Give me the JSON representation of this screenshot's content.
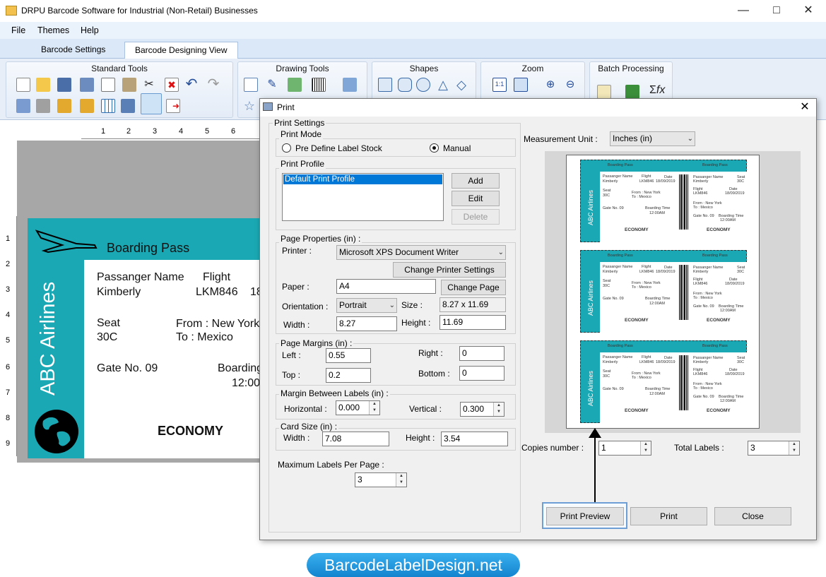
{
  "window": {
    "title": "DRPU Barcode Software for Industrial (Non-Retail) Businesses"
  },
  "menu": [
    "File",
    "Themes",
    "Help"
  ],
  "tabs": [
    {
      "label": "Barcode Settings"
    },
    {
      "label": "Barcode Designing View"
    }
  ],
  "ribbon_groups": [
    "Standard Tools",
    "Drawing Tools",
    "Shapes",
    "Zoom",
    "Batch Processing"
  ],
  "ruler_h": [
    "1",
    "2",
    "3",
    "4",
    "5",
    "6"
  ],
  "ruler_v": [
    "1",
    "2",
    "3",
    "4",
    "5",
    "6",
    "7",
    "8",
    "9"
  ],
  "label": {
    "title": "Boarding Pass",
    "airline": "ABC Airlines",
    "passenger_label": "Passanger Name",
    "passenger": "Kimberly",
    "flight_label": "Flight",
    "flight": "LKM846",
    "flight_cut": "18",
    "seat_label": "Seat",
    "seat": "30C",
    "from": "From : New York",
    "to": "To : Mexico",
    "gate": "Gate No. 09",
    "boarding": "Boarding",
    "boarding_time": "12:00",
    "class": "ECONOMY"
  },
  "dialog": {
    "title": "Print",
    "print_settings": "Print Settings",
    "print_mode": "Print Mode",
    "mode_predefined": "Pre Define Label Stock",
    "mode_manual": "Manual",
    "print_profile": "Print Profile",
    "profiles": [
      "Default Print Profile"
    ],
    "btn_add": "Add",
    "btn_edit": "Edit",
    "btn_delete": "Delete",
    "page_properties": "Page Properties (in) :",
    "printer_label": "Printer :",
    "printer": "Microsoft XPS Document Writer",
    "btn_change_printer": "Change Printer Settings",
    "paper_label": "Paper :",
    "paper": "A4",
    "btn_change_page": "Change Page",
    "orientation_label": "Orientation :",
    "orientation": "Portrait",
    "size_label": "Size :",
    "size": "8.27 x 11.69",
    "width_label": "Width :",
    "width": "8.27",
    "height_label": "Height :",
    "height": "11.69",
    "page_margins": "Page Margins (in) :",
    "left_label": "Left :",
    "left": "0.55",
    "right_label": "Right :",
    "right": "0",
    "top_label": "Top :",
    "top": "0.2",
    "bottom_label": "Bottom :",
    "bottom": "0",
    "margin_between": "Margin Between Labels (in) :",
    "horizontal_label": "Horizontal :",
    "horizontal": "0.000",
    "vertical_label": "Vertical :",
    "vertical": "0.300",
    "card_size": "Card Size (in) :",
    "card_width_label": "Width :",
    "card_width": "7.08",
    "card_height_label": "Height :",
    "card_height": "3.54",
    "max_labels_label": "Maximum Labels Per Page :",
    "max_labels": "3",
    "measurement_label": "Measurement Unit :",
    "measurement": "Inches (in)",
    "copies_label": "Copies number :",
    "copies": "1",
    "total_label": "Total Labels :",
    "total": "3",
    "btn_preview": "Print Preview",
    "btn_print": "Print",
    "btn_close": "Close"
  },
  "mini_label": {
    "title": "Boarding Pass",
    "airline": "ABC Airlines",
    "passenger_label": "Passanger Name",
    "passenger": "Kimberly",
    "flight_label": "Flight",
    "flight": "LKM846",
    "date_label": "Date",
    "date": "18/09/2019",
    "seat_label": "Seat",
    "seat": "30C",
    "from": "From : New York",
    "to": "To : Mexico",
    "gate": "Gate No. 09",
    "boarding_label": "Boarding Time",
    "boarding_time": "12:00AM",
    "class": "ECONOMY"
  },
  "brand": "BarcodeLabelDesign.net"
}
